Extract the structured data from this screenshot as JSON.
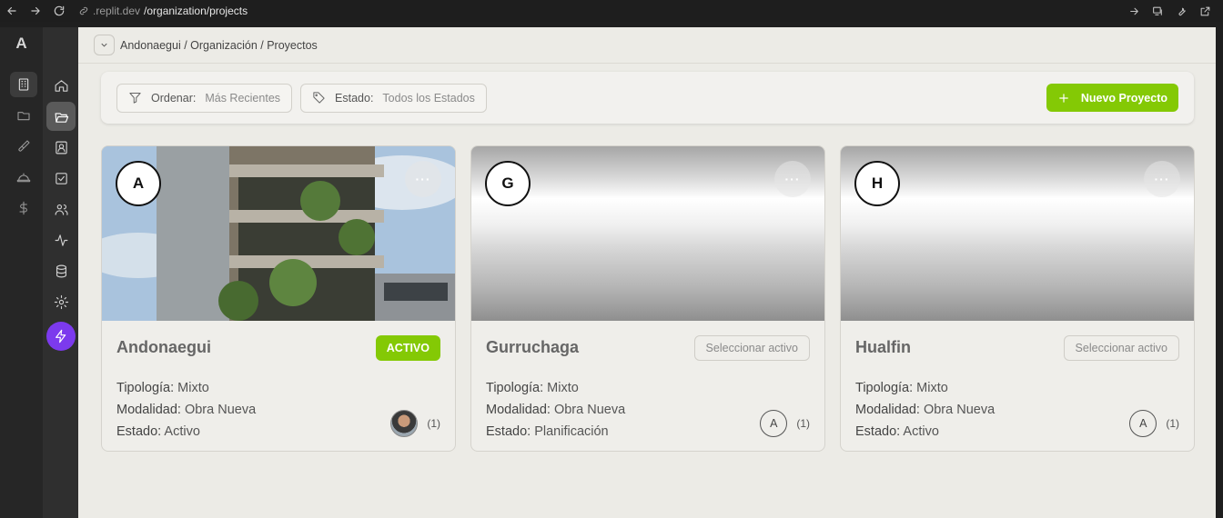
{
  "browser": {
    "url_host": ".replit.dev",
    "url_path": "/organization/projects"
  },
  "app": {
    "logo_letter": "A"
  },
  "breadcrumb": "Andonaegui / Organización / Proyectos",
  "filters": {
    "sort_label": "Ordenar:",
    "sort_value": "Más Recientes",
    "status_label": "Estado:",
    "status_value": "Todos los Estados"
  },
  "new_project_label": "Nuevo Proyecto",
  "projects": [
    {
      "initial": "A",
      "name": "Andonaegui",
      "status_button": "ACTIVO",
      "tipologia": "Mixto",
      "modalidad": "Obra Nueva",
      "estado": "Activo",
      "member_count": "(1)"
    },
    {
      "initial": "G",
      "name": "Gurruchaga",
      "status_button": "Seleccionar activo",
      "tipologia": "Mixto",
      "modalidad": "Obra Nueva",
      "estado": "Planificación",
      "member_initial": "A",
      "member_count": "(1)"
    },
    {
      "initial": "H",
      "name": "Hualfin",
      "status_button": "Seleccionar activo",
      "tipologia": "Mixto",
      "modalidad": "Obra Nueva",
      "estado": "Activo",
      "member_initial": "A",
      "member_count": "(1)"
    }
  ],
  "labels": {
    "tipologia": "Tipología:",
    "modalidad": "Modalidad:",
    "estado": "Estado:",
    "dots": "···"
  },
  "colors": {
    "accent": "#84c905",
    "bolt": "#7c3aed"
  }
}
